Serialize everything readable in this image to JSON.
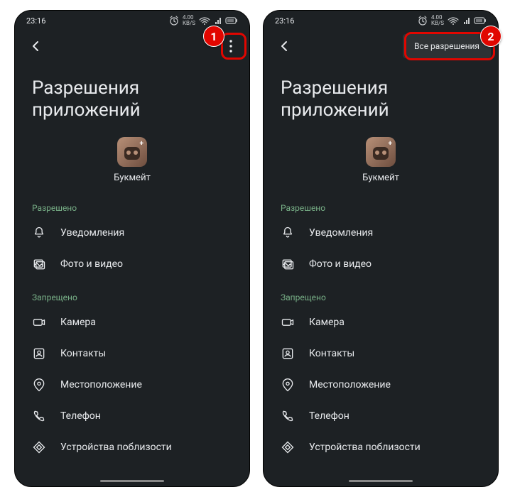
{
  "time": "23:16",
  "title": "Разрешения приложений",
  "app_name": "Букмейт",
  "menu_item": "Все разрешения",
  "allowed_label": "Разрешено",
  "denied_label": "Запрещено",
  "badges": {
    "one": "1",
    "two": "2"
  },
  "allowed": [
    {
      "icon": "bell",
      "label": "Уведомления"
    },
    {
      "icon": "photo",
      "label": "Фото и видео"
    }
  ],
  "denied": [
    {
      "icon": "camera",
      "label": "Камера"
    },
    {
      "icon": "contacts",
      "label": "Контакты"
    },
    {
      "icon": "location",
      "label": "Местоположение"
    },
    {
      "icon": "phone",
      "label": "Телефон"
    },
    {
      "icon": "nearby",
      "label": "Устройства поблизости"
    }
  ]
}
